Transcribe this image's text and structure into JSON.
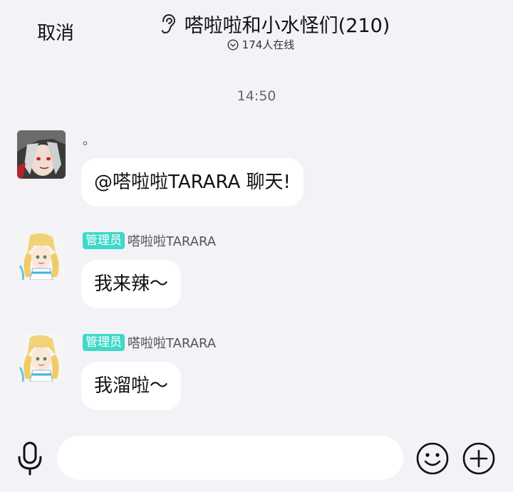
{
  "header": {
    "cancel_label": "取消",
    "title": "嗒啦啦和小水怪们(210)",
    "online_text": "174人在线",
    "ear_icon": "ear-icon",
    "chevron_icon": "chevron-down-circle-icon"
  },
  "timestamp": "14:50",
  "messages": [
    {
      "sender": "。",
      "badge": "",
      "text": "@嗒啦啦TARARA  聊天!"
    },
    {
      "sender": "嗒啦啦TARARA",
      "badge": "管理员",
      "text": "我来辣〜"
    },
    {
      "sender": "嗒啦啦TARARA",
      "badge": "管理员",
      "text": "我溜啦〜"
    }
  ],
  "input_bar": {
    "placeholder": "",
    "mic_icon": "microphone-icon",
    "emoji_icon": "emoji-icon",
    "plus_icon": "plus-icon"
  },
  "colors": {
    "background": "#f2f2f7",
    "bubble": "#ffffff",
    "badge": "#3fd8c9"
  }
}
